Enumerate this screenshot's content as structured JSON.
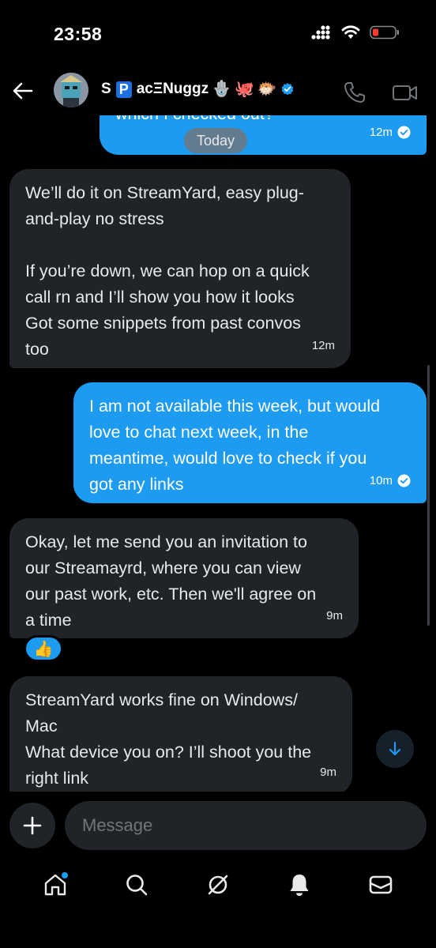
{
  "status_bar": {
    "time": "23:58",
    "icons": [
      "signal-icon",
      "wifi-icon",
      "battery-low-icon"
    ],
    "battery_color": "#ff3b30"
  },
  "header": {
    "back_icon": "arrow-left-icon",
    "avatar_icon": "avatar",
    "name_part1": "S",
    "name_boxed": "P",
    "name_part2": "acΞNuggz",
    "emojis": [
      "🪬",
      "🐙",
      "🐡"
    ],
    "verified": true,
    "call_icon": "phone-icon",
    "video_icon": "video-icon"
  },
  "date_separator": "Today",
  "messages": [
    {
      "direction": "out",
      "text": "which I checked out?",
      "time": "12m",
      "read": true
    },
    {
      "direction": "in",
      "text": "We’ll do it on StreamYard, easy plug-\nand-play no stress\n\nIf you’re down, we can hop on a quick\ncall rn and I’ll show you how it looks\nGot some snippets from past convos\ntoo",
      "time": "12m"
    },
    {
      "direction": "out",
      "text": "I am not available this week, but would\nlove to chat next week, in the\nmeantime, would love to check if you\ngot any links",
      "time": "10m",
      "read": true
    },
    {
      "direction": "in",
      "text": "Okay, let me send you an invitation to\nour Streamayrd, where you can view\nour past work, etc. Then we'll agree on\na time",
      "time": "9m",
      "reaction": "👍"
    },
    {
      "direction": "in",
      "text": "StreamYard works fine on Windows/\nMac\nWhat device you on? I’ll shoot you the\nright link",
      "time": "9m"
    }
  ],
  "composer": {
    "add_icon": "plus-icon",
    "placeholder": "Message"
  },
  "bottom_nav": [
    {
      "name": "home",
      "icon": "home-icon",
      "badge": true
    },
    {
      "name": "search",
      "icon": "search-icon"
    },
    {
      "name": "grok",
      "icon": "grok-icon"
    },
    {
      "name": "notifications",
      "icon": "bell-icon"
    },
    {
      "name": "messages",
      "icon": "mail-icon"
    }
  ],
  "colors": {
    "accent": "#1d9bf0",
    "incoming_bubble": "#202327",
    "background": "#000000"
  }
}
